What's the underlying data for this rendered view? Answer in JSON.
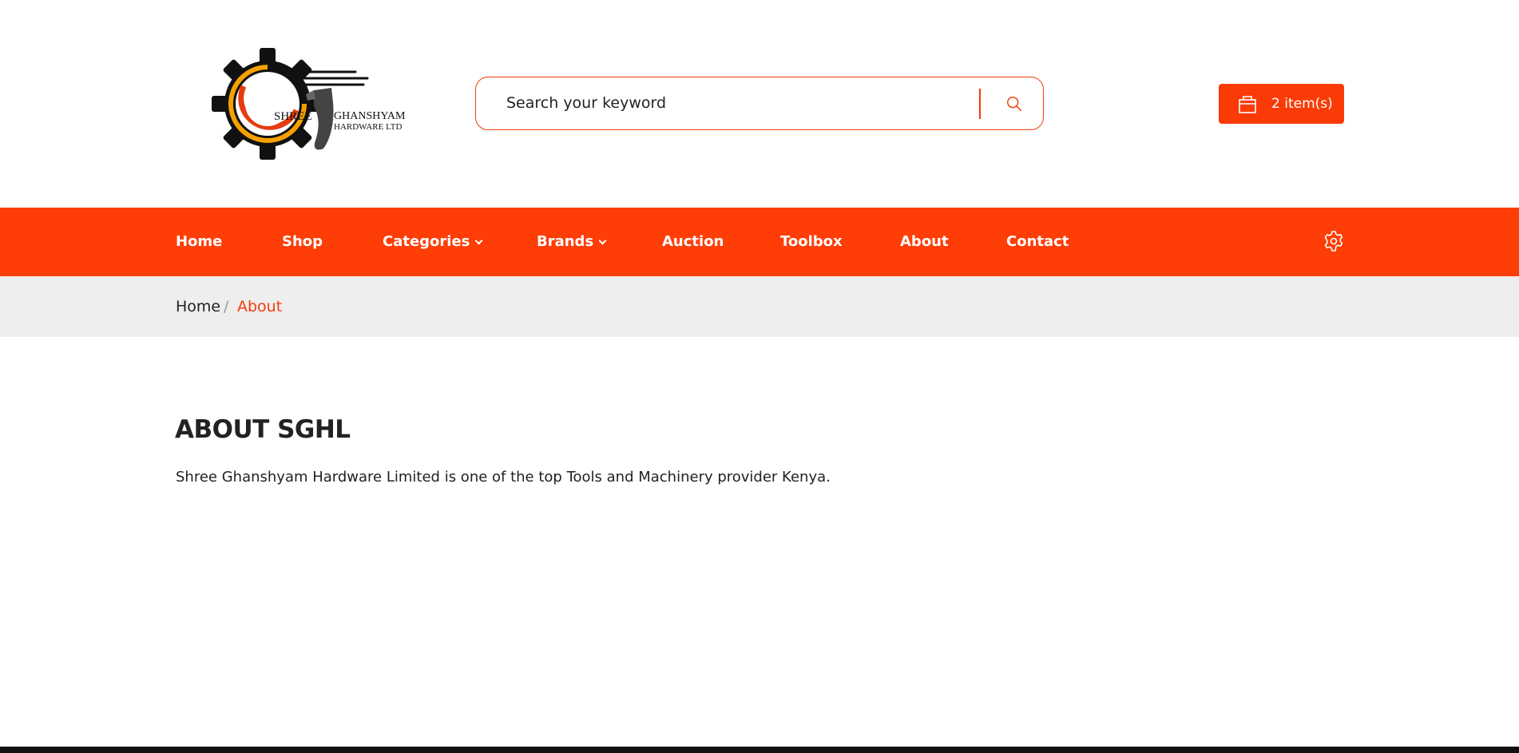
{
  "brand": {
    "logo_line1": "SHREE",
    "logo_line2": "GHANSHYAM",
    "logo_line3": "HARDWARE LTD",
    "accent_color": "#ff3d06",
    "logo_gear_color": "#111111",
    "logo_ring_colors": [
      "#f5a000",
      "#e53b0e"
    ]
  },
  "search": {
    "placeholder": "Search your keyword",
    "icon": "search-icon"
  },
  "cart": {
    "label": "2 item(s)",
    "icon": "shopping-bag-icon"
  },
  "nav": {
    "items": [
      {
        "label": "Home"
      },
      {
        "label": "Shop"
      },
      {
        "label": "Categories",
        "dropdown": true
      },
      {
        "label": "Brands",
        "dropdown": true
      },
      {
        "label": "Auction"
      },
      {
        "label": "Toolbox"
      },
      {
        "label": "About"
      },
      {
        "label": "Contact"
      }
    ],
    "settings_icon": "gear-icon"
  },
  "breadcrumb": {
    "home": "Home",
    "separator": "/",
    "current": "About"
  },
  "content": {
    "title": "ABOUT SGHL",
    "description": "Shree Ghanshyam Hardware Limited is one of the top Tools and Machinery provider Kenya."
  }
}
